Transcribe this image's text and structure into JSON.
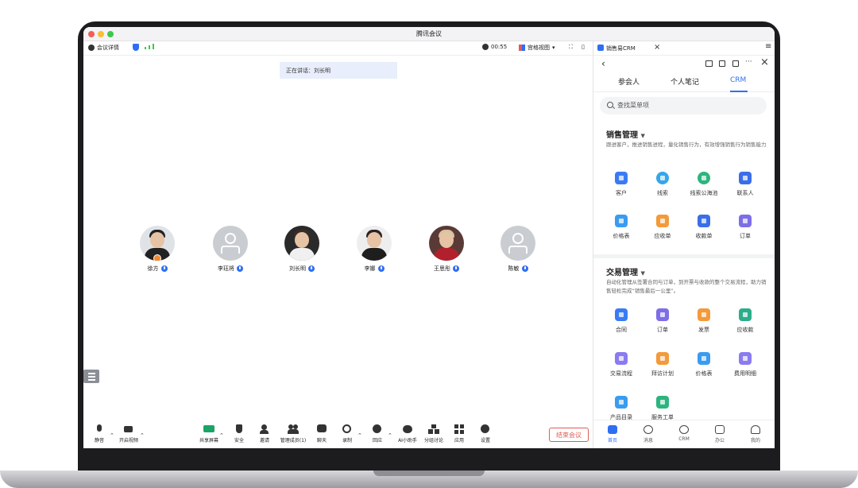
{
  "window": {
    "title": "腾讯会议"
  },
  "top_toolbar": {
    "meeting_details": "会议详情",
    "timer": "00:55",
    "view_mode": "宫格视图"
  },
  "speaking_banner": "正在讲话：刘长明",
  "participants": [
    {
      "name": "徐方",
      "avatar": "photo"
    },
    {
      "name": "李珏将",
      "avatar": "blank"
    },
    {
      "name": "刘长明",
      "avatar": "photo"
    },
    {
      "name": "李娜",
      "avatar": "photo"
    },
    {
      "name": "王思彤",
      "avatar": "photo"
    },
    {
      "name": "陈敏",
      "avatar": "blank"
    }
  ],
  "bottom_toolbar": {
    "mute": "静音",
    "video": "开启视频",
    "share": "共享屏幕",
    "security": "安全",
    "invite": "邀请",
    "members": "管理成员(1)",
    "chat": "聊天",
    "record": "录制",
    "reaction": "回应",
    "ai": "AI小助手",
    "breakout": "分组讨论",
    "apps": "应用",
    "settings": "设置",
    "end": "结束会议"
  },
  "panel": {
    "app_name": "销售易CRM",
    "tabs": [
      "参会人",
      "个人笔记",
      "CRM"
    ],
    "search_placeholder": "查找菜单项",
    "sales": {
      "title": "销售管理",
      "desc": "跟进客户，推进销售进程，量化销售行为，有效增强销售行为销售能力",
      "items": [
        "客户",
        "线索",
        "线索公海池",
        "联系人",
        "价格表",
        "应收单",
        "收款单",
        "订单"
      ]
    },
    "trade": {
      "title": "交易管理",
      "desc": "自动化管理从签署合同与订单，到开票与收款的整个交易流程，助力销售轻松完成“销售最后一公里”。",
      "items": [
        "合同",
        "订单",
        "发票",
        "应收款",
        "交易流程",
        "拜访计划",
        "价格表",
        "费用明细",
        "产品目录",
        "服务工单"
      ]
    },
    "nav": [
      "首页",
      "消息",
      "CRM",
      "办公",
      "我的"
    ]
  },
  "colors": {
    "accent": "#2f6ef3",
    "end_button": "#e25b55"
  }
}
